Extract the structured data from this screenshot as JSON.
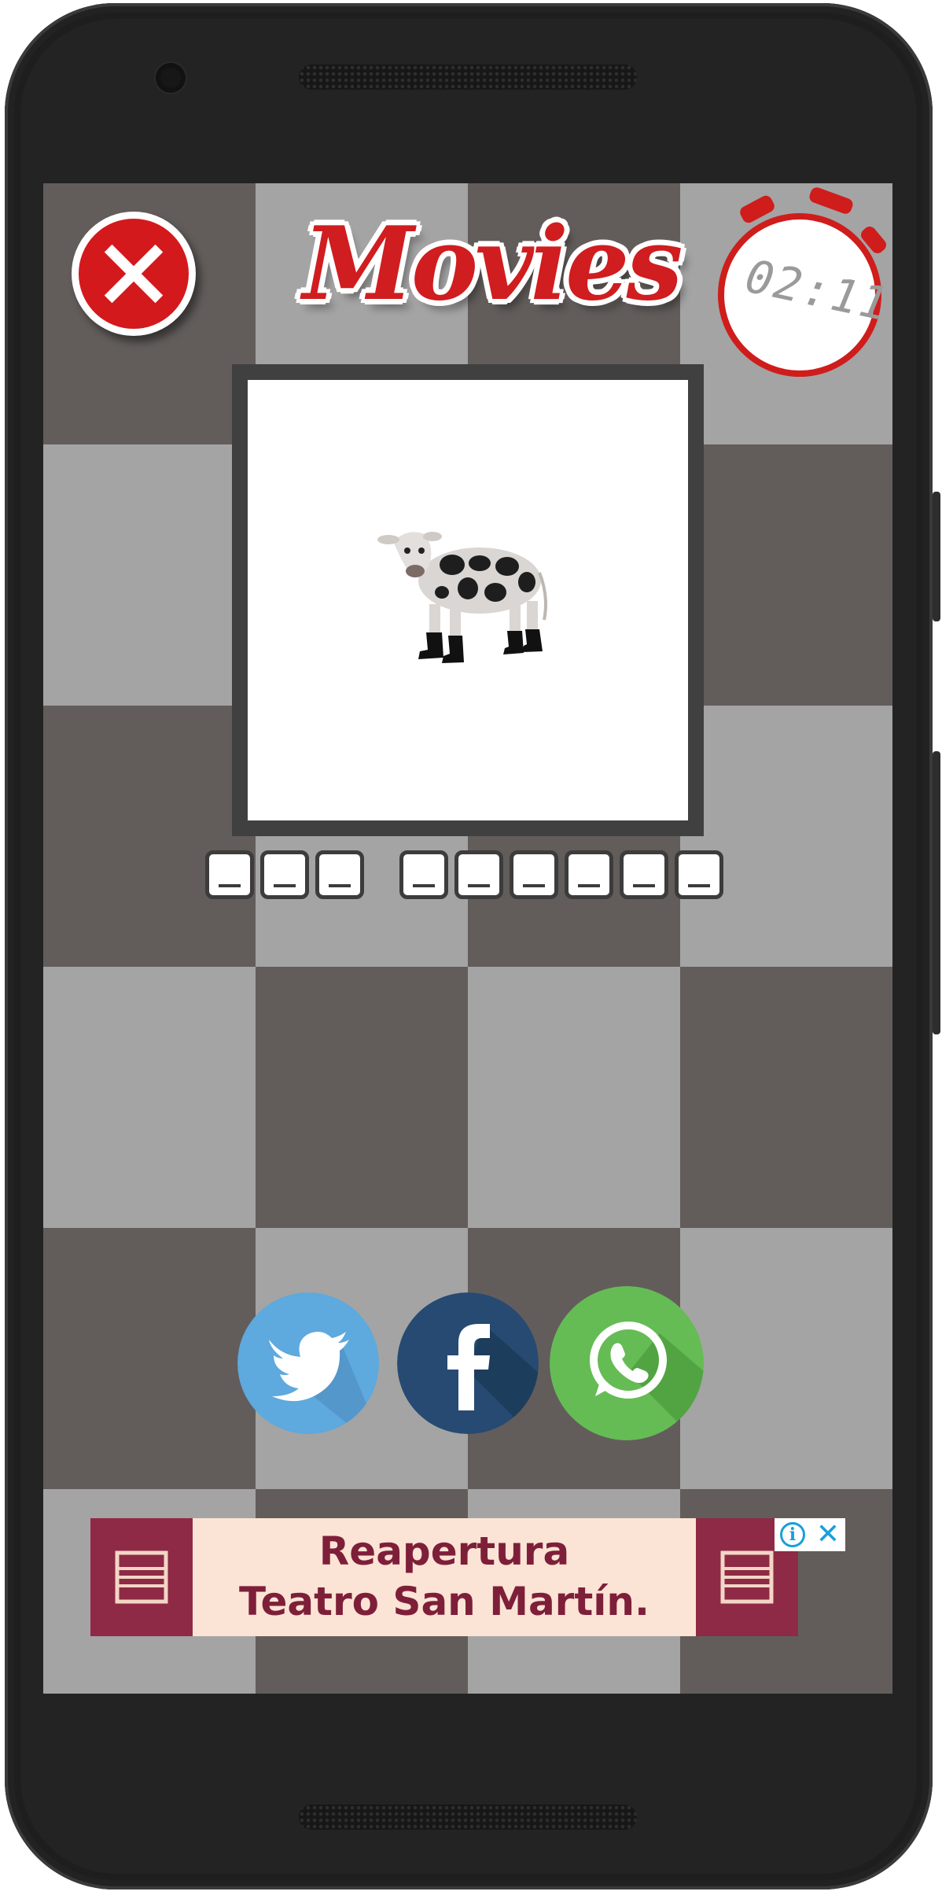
{
  "app": {
    "title": "Movies",
    "timer": "02:11"
  },
  "puzzle": {
    "image_subject": "cow-with-boots",
    "answer_words": [
      3,
      6
    ]
  },
  "social": {
    "buttons": [
      {
        "icon": "twitter-icon",
        "color": "#5ea9dd"
      },
      {
        "icon": "facebook-icon",
        "color": "#3b5998"
      },
      {
        "icon": "whatsapp-icon",
        "color": "#65bc54"
      }
    ]
  },
  "ad": {
    "line1": "Reapertura",
    "line2": "Teatro San Martín.",
    "info_glyph": "i",
    "close_glyph": "✕"
  },
  "colors": {
    "accent_red": "#d01d1f",
    "checker_dark": "#625d5b",
    "checker_light": "#a4a4a4",
    "ad_maroon": "#8e2a45",
    "ad_bg": "#fbe4d5"
  }
}
